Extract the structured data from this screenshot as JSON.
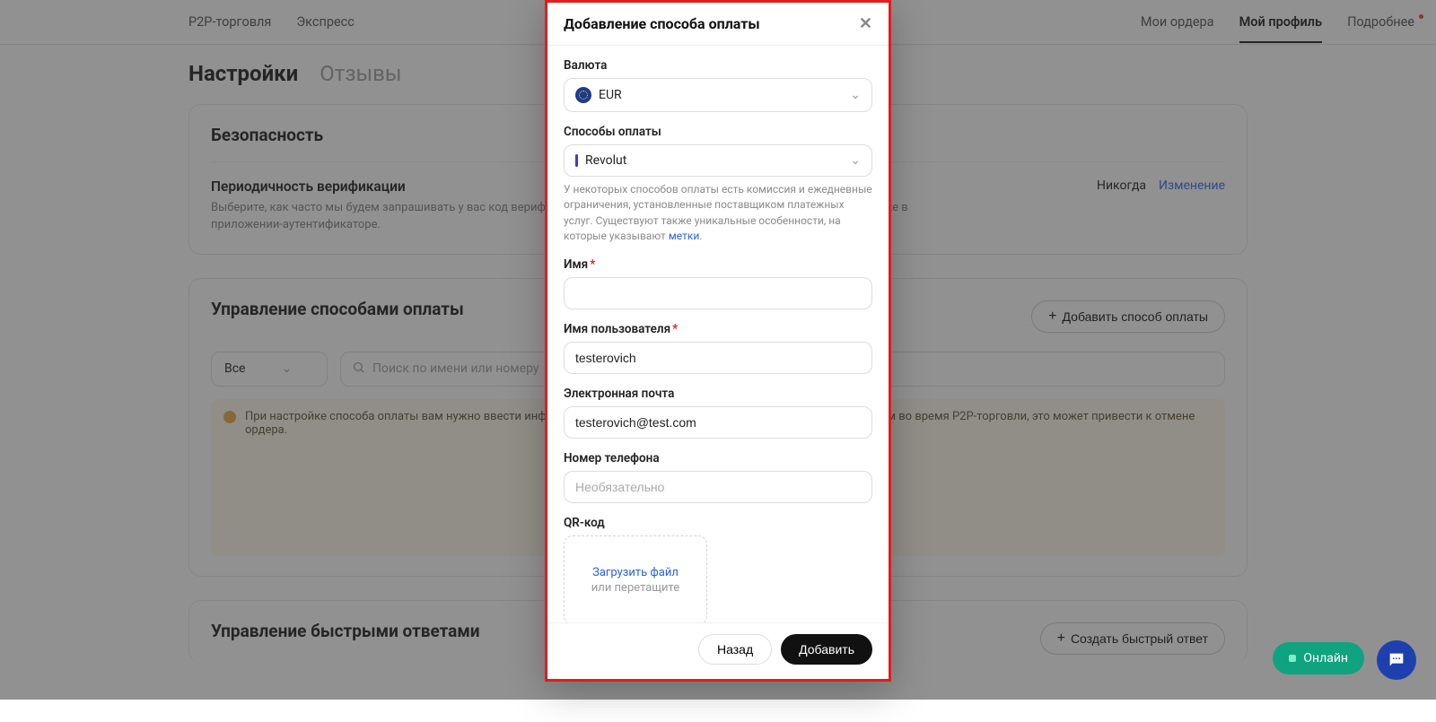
{
  "nav": {
    "left": [
      "P2P-торговля",
      "Экспресс"
    ],
    "right": [
      "Мои ордера",
      "Мой профиль",
      "Подробнее"
    ],
    "active_right": 1
  },
  "page_tabs": {
    "settings": "Настройки",
    "reviews": "Отзывы"
  },
  "security": {
    "title": "Безопасность",
    "sub_title": "Периодичность верификации",
    "sub_text": "Выберите, как часто мы будем запрашивать у вас код верификации. Мы отправим его по электронной почте, в SMS, а также в приложении-аутентификаторе.",
    "never": "Никогда",
    "change": "Изменение"
  },
  "pm": {
    "title": "Управление способами оплаты",
    "add_btn": "Добавить способ оплаты",
    "filter_all": "Все",
    "search_placeholder": "Поиск по имени или номеру",
    "notice": "При настройке способа оплаты вам нужно ввести информацию. Если данные неверны и контрагент сообщит об этом во время P2P-торговли, это может привести к отмене ордера."
  },
  "qr_section": {
    "title": "Управление быстрыми ответами",
    "create_btn": "Создать быстрый ответ"
  },
  "modal": {
    "title": "Добавление способа оплаты",
    "fields": {
      "currency_label": "Валюта",
      "currency_value": "EUR",
      "method_label": "Способы оплаты",
      "method_value": "Revolut",
      "method_helper_pre": "У некоторых способов оплаты есть комиссия и ежедневные ограничения, установленные поставщиком платежных услуг. Существуют также уникальные особенности, на которые указывают ",
      "method_helper_link": "метки",
      "name_label": "Имя",
      "name_value": "",
      "user_label": "Имя пользователя",
      "user_value": "testerovich",
      "email_label": "Электронная почта",
      "email_value": "testerovich@test.com",
      "phone_label": "Номер телефона",
      "phone_placeholder": "Необязательно",
      "qr_label": "QR-код",
      "upload_link": "Загрузить файл",
      "upload_sub": "или перетащите"
    },
    "back": "Назад",
    "submit": "Добавить"
  },
  "widgets": {
    "online": "Онлайн"
  }
}
